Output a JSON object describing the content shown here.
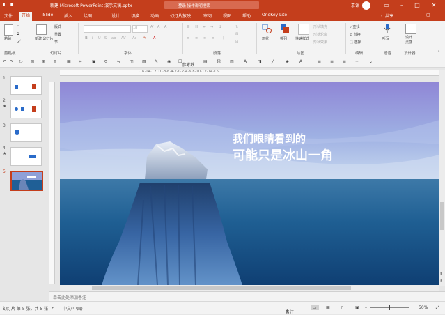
{
  "titlebar": {
    "doc_title": "新建 Microsoft PowerPoint 演示文稿.pptx",
    "search_placeholder": "登录  操作说明搜索",
    "user_glyph": "慕课"
  },
  "tabs": [
    "文件",
    "开始",
    "iSlide",
    "插入",
    "绘图",
    "设计",
    "切换",
    "动画",
    "幻灯片放映",
    "审阅",
    "视图",
    "帮助",
    "OneKey Lite"
  ],
  "active_tab": "开始",
  "share_label": "共享",
  "ribbon": {
    "groups": [
      "剪贴板",
      "幻灯片",
      "字体",
      "段落",
      "绘图",
      "编辑",
      "语音",
      "设计器"
    ],
    "paste_label": "粘贴",
    "new_slide_label": "新建\n幻灯片",
    "layout_label": "版式",
    "reset_label": "重置",
    "section_label": "节",
    "font_name": "",
    "font_size": "18",
    "shape_label": "形状",
    "arrange_label": "排列",
    "quick_styles_label": "快速样式",
    "shape_fill": "形状填充",
    "shape_outline": "形状轮廓",
    "shape_effects": "形状效果",
    "find_label": "查找",
    "replace_label": "替换",
    "select_label": "选择",
    "dictate_label": "听写",
    "designer_label": "设计\n灵感"
  },
  "qat": {
    "reference_line": "参考线"
  },
  "ruler_text": "·16·14·12·10·8·6·4·2·0·2·4·6·8·10·12·14·16·",
  "thumbnails": [
    {
      "num": "1",
      "star": ""
    },
    {
      "num": "2",
      "star": "★"
    },
    {
      "num": "3",
      "star": ""
    },
    {
      "num": "4",
      "star": "★"
    },
    {
      "num": "5",
      "star": ""
    }
  ],
  "slide": {
    "line1": "我们眼睛看到的",
    "line2": "可能只是冰山一角"
  },
  "notes_placeholder": "单击此处添加备注",
  "status": {
    "slide_count": "幻灯片 第 5 张，共 5 张",
    "language": "中文(中国)",
    "notes_btn": "备注",
    "zoom": "50%"
  },
  "colors": {
    "accent": "#c43e1c"
  }
}
